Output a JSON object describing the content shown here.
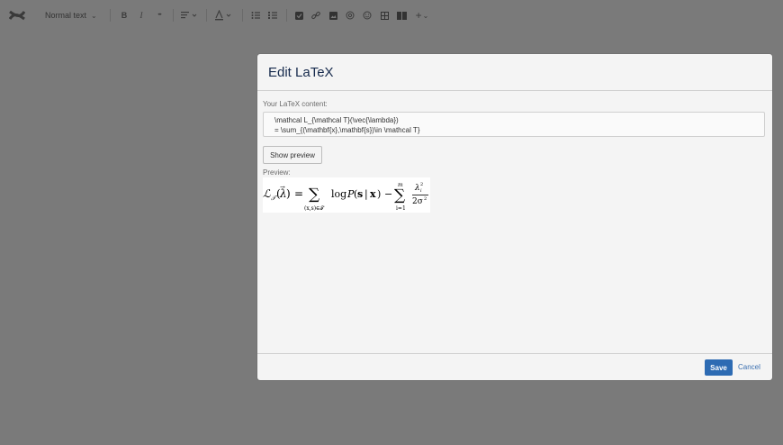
{
  "toolbar": {
    "text_style": "Normal text",
    "bold": "B",
    "italic": "I",
    "more": "•••",
    "insert": "+"
  },
  "modal": {
    "title": "Edit LaTeX",
    "content_label": "Your LaTeX content:",
    "latex_line1": "\\mathcal L_{\\mathcal T}(\\vec{\\lambda})",
    "latex_line2": "= \\sum_{(\\mathbf{x},\\mathbf{s})\\in \\mathcal T}",
    "show_preview": "Show preview",
    "preview_label": "Preview:",
    "save": "Save",
    "cancel": "Cancel"
  },
  "colors": {
    "save_button": "#2d6bb3",
    "title": "#172b4d",
    "overlay": "#7a7a7a"
  }
}
